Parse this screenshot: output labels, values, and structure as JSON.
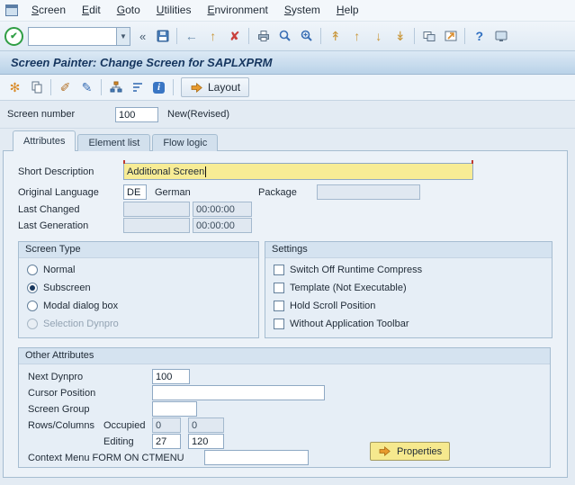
{
  "menu_bar": {
    "items": [
      "Screen",
      "Edit",
      "Goto",
      "Utilities",
      "Environment",
      "System",
      "Help"
    ]
  },
  "system_toolbar": {
    "command_field_value": "",
    "icons": {
      "enter": "✔",
      "dropdown": "▼",
      "collapse": "«",
      "save": "floppy-shape",
      "back": "←",
      "exit": "↑",
      "cancel": "✘",
      "print": "printer-shape",
      "find": "magnifier-shape",
      "find_next": "magnifier-plus-shape",
      "first_page": "↟",
      "prev_page": "↑",
      "next_page": "↓",
      "last_page": "↡",
      "new_session": "overlapping-windows-shape",
      "shortcut": "window-arrow-shape",
      "help": "?",
      "customize": "monitor-shape"
    }
  },
  "title_bar": {
    "title": "Screen Painter: Change Screen for SAPLXPRM"
  },
  "app_toolbar": {
    "icons": {
      "wand": "✻",
      "copy": "sheets-shape",
      "brush": "✐",
      "pencil": "✎",
      "hierarchy": "hierarchy-shape",
      "sort": "list-lines-shape",
      "info": "i"
    },
    "layout_button_label": "Layout"
  },
  "header": {
    "screen_number_label": "Screen number",
    "screen_number_value": "100",
    "status": "New(Revised)"
  },
  "tabs": {
    "items": [
      {
        "label": "Attributes",
        "active": true
      },
      {
        "label": "Element list",
        "active": false
      },
      {
        "label": "Flow logic",
        "active": false
      }
    ]
  },
  "attributes_form": {
    "short_description": {
      "label": "Short Description",
      "value": "Additional Screen"
    },
    "original_language": {
      "label": "Original Language",
      "value": "DE",
      "language_name": "German"
    },
    "package": {
      "label": "Package",
      "value": ""
    },
    "last_changed": {
      "label": "Last Changed",
      "date": "",
      "time": "00:00:00"
    },
    "last_generation": {
      "label": "Last Generation",
      "date": "",
      "time": "00:00:00"
    }
  },
  "screen_type_group": {
    "title": "Screen Type",
    "options": [
      {
        "label": "Normal",
        "selected": false,
        "disabled": false
      },
      {
        "label": "Subscreen",
        "selected": true,
        "disabled": false
      },
      {
        "label": "Modal dialog box",
        "selected": false,
        "disabled": false
      },
      {
        "label": "Selection Dynpro",
        "selected": false,
        "disabled": true
      }
    ]
  },
  "settings_group": {
    "title": "Settings",
    "options": [
      {
        "label": "Switch Off Runtime Compress",
        "checked": false
      },
      {
        "label": "Template (Not Executable)",
        "checked": false
      },
      {
        "label": "Hold Scroll Position",
        "checked": false
      },
      {
        "label": "Without Application Toolbar",
        "checked": false
      }
    ]
  },
  "other_attributes_group": {
    "title": "Other Attributes",
    "next_dynpro": {
      "label": "Next Dynpro",
      "value": "100"
    },
    "cursor_position": {
      "label": "Cursor Position",
      "value": ""
    },
    "screen_group": {
      "label": "Screen Group",
      "value": ""
    },
    "rows_columns": {
      "label": "Rows/Columns",
      "occupied_label": "Occupied",
      "occupied_rows": "0",
      "occupied_columns": "0",
      "editing_label": "Editing",
      "editing_rows": "27",
      "editing_columns": "120"
    },
    "context_menu": {
      "label": "Context Menu FORM ON CTMENU",
      "value": ""
    },
    "properties_button_label": "Properties"
  },
  "colors": {
    "accent_yellow": "#f6e98e",
    "title_text": "#16365f",
    "arrow_orange": "#e79a2e",
    "cancel_red": "#c9403c",
    "enter_green": "#2f9e44"
  }
}
